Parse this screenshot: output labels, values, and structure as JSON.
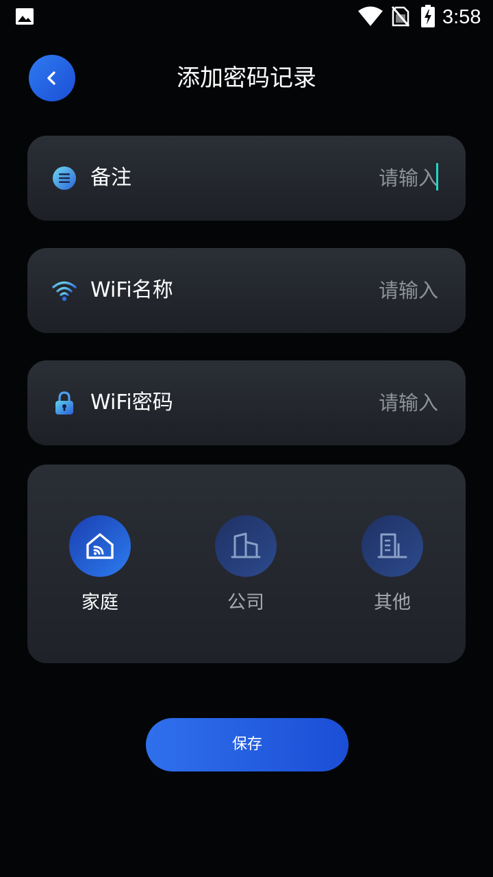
{
  "status_bar": {
    "time": "3:58",
    "icons": [
      "image-icon",
      "wifi-signal-icon",
      "no-sim-icon",
      "battery-charging-icon"
    ]
  },
  "header": {
    "title": "添加密码记录",
    "back_icon": "chevron-left-icon"
  },
  "fields": [
    {
      "label": "备注",
      "icon": "note-icon",
      "placeholder": "请输入",
      "value": "",
      "focused": true
    },
    {
      "label": "WiFi名称",
      "icon": "wifi-icon",
      "placeholder": "请输入",
      "value": ""
    },
    {
      "label": "WiFi密码",
      "icon": "lock-icon",
      "placeholder": "请输入",
      "value": ""
    }
  ],
  "categories": [
    {
      "label": "家庭",
      "icon": "home-icon",
      "selected": true
    },
    {
      "label": "公司",
      "icon": "company-building-icon",
      "selected": false
    },
    {
      "label": "其他",
      "icon": "other-building-icon",
      "selected": false
    }
  ],
  "save_label": "保存",
  "colors": {
    "background": "#030507",
    "card": "#2b2f36",
    "accent": "#2f70ec",
    "cursor": "#1fd6c8",
    "placeholder": "#8d9198"
  }
}
